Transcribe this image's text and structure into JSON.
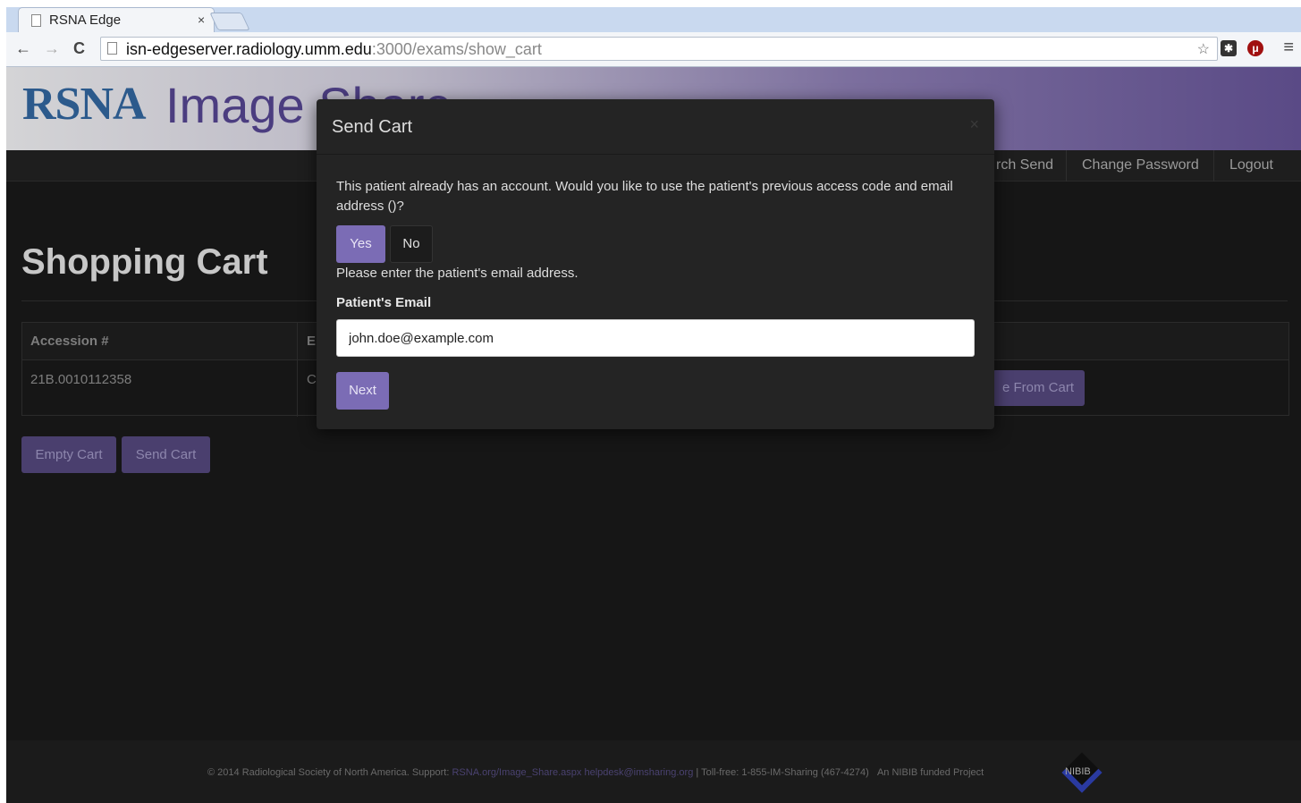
{
  "browser": {
    "tab_title": "RSNA Edge",
    "tab_close": "×",
    "url_host": "isn-edgeserver.radiology.umm.edu",
    "url_path": ":3000/exams/show_cart"
  },
  "header": {
    "logo_rsna": "RSNA",
    "logo_image": "Image Share"
  },
  "nav": {
    "items": [
      "Search Send",
      "Change Password",
      "Logout"
    ],
    "visible_partial": "rch Send"
  },
  "cart": {
    "title": "Shopping Cart",
    "columns": [
      "Accession #",
      "E"
    ],
    "rows": [
      {
        "accession": "21B.0010112358",
        "exam_partial": "C",
        "remove_label": "e From Cart"
      }
    ],
    "empty_label": "Empty Cart",
    "send_label": "Send Cart"
  },
  "modal": {
    "title": "Send Cart",
    "close": "×",
    "message": "This patient already has an account. Would you like to use the patient's previous access code and email address ()?",
    "yes_label": "Yes",
    "no_label": "No",
    "prompt": "Please enter the patient's email address.",
    "email_label": "Patient's Email",
    "email_value": "john.doe@example.com",
    "next_label": "Next"
  },
  "footer": {
    "copyright": "© 2014 Radiological Society of North America. Support:",
    "link1": "RSNA.org/Image_Share.aspx",
    "link2": "helpdesk@imsharing.org",
    "tollfree": "| Toll-free: 1-855-IM-Sharing (467-4274)",
    "funded": "An NIBIB funded Project",
    "nibib_logo": "NIBIB"
  },
  "colors": {
    "accent": "#7b6cb5",
    "page_bg": "#161616"
  }
}
